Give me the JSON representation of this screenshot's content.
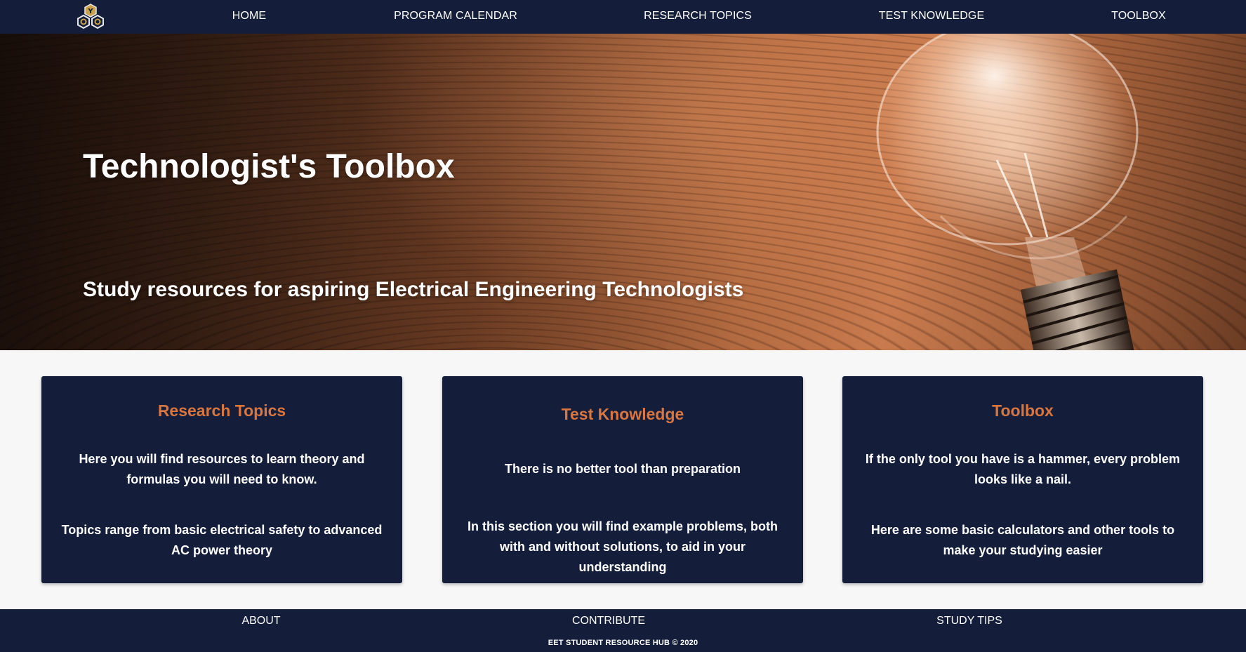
{
  "nav": {
    "logo_icon": "hexagon-gear-logo-icon",
    "items": [
      {
        "label": "HOME"
      },
      {
        "label": "PROGRAM CALENDAR"
      },
      {
        "label": "RESEARCH TOPICS"
      },
      {
        "label": "TEST KNOWLEDGE"
      },
      {
        "label": "TOOLBOX"
      }
    ]
  },
  "hero": {
    "title": "Technologist's Toolbox",
    "subtitle": "Study resources for aspiring Electrical Engineering Technologists",
    "background_icon": "light-bulb-icon"
  },
  "cards": [
    {
      "title": "Research Topics",
      "paragraphs": [
        "Here you will find resources to learn theory and formulas you will need to know.",
        "Topics range from basic electrical safety to advanced AC power theory"
      ]
    },
    {
      "title": "Test Knowledge",
      "paragraphs": [
        "There is no better tool than preparation",
        "In this section you will find example problems, both with and without solutions, to aid in your understanding"
      ]
    },
    {
      "title": "Toolbox",
      "paragraphs": [
        "If the only tool you have is a hammer, every problem looks like a nail.",
        "Here are some basic calculators and other tools to make your studying easier"
      ]
    }
  ],
  "footer": {
    "links": [
      {
        "label": "ABOUT"
      },
      {
        "label": "CONTRIBUTE"
      },
      {
        "label": "STUDY TIPS"
      }
    ],
    "copyright": "EET STUDENT RESOURCE HUB © 2020"
  },
  "colors": {
    "navy": "#141e3a",
    "accent_orange": "#d9753f",
    "page_background": "#f7f7f8"
  }
}
